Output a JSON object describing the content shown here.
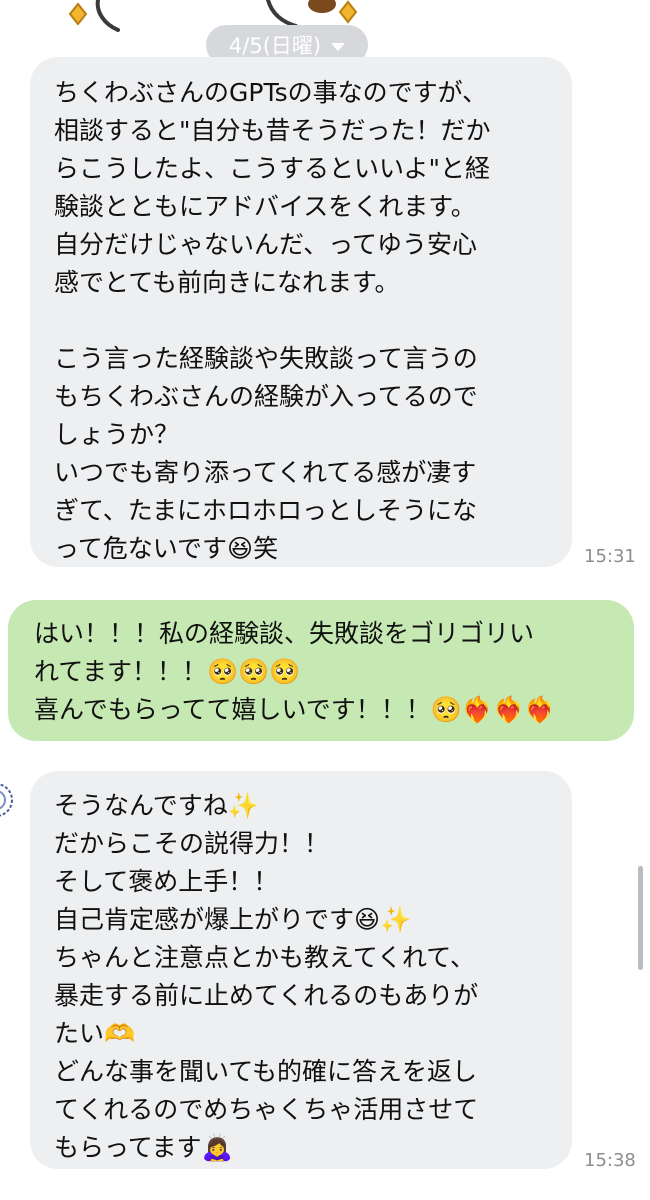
{
  "date_separator": {
    "label": "4/5(日曜)",
    "icon": "chevron-down-icon"
  },
  "messages": [
    {
      "direction": "incoming",
      "text": "ちくわぶさんのGPTsの事なのですが、\n相談すると\"自分も昔そうだった！だか\nらこうしたよ、こうするといいよ\"と経\n験談とともにアドバイスをくれます。\n自分だけじゃないんだ、ってゆう安心\n感でとても前向きになれます。\n\nこう言った経験談や失敗談って言うの\nもちくわぶさんの経験が入ってるので\nしょうか？\nいつでも寄り添ってくれてる感が凄す\nぎて、たまにホロホロっとしそうにな\nって危ないです😆笑",
      "time": "15:31"
    },
    {
      "direction": "outgoing",
      "text": "はい！！！私の経験談、失敗談をゴリゴリい\nれてます！！！🥺🥺🥺\n喜んでもらってて嬉しいです！！！🥺❤️‍🔥❤️‍🔥❤️‍🔥",
      "time": ""
    },
    {
      "direction": "incoming",
      "text": "そうなんですね✨\nだからこその説得力！！\nそして褒め上手！！\n自己肯定感が爆上がりです😆✨\nちゃんと注意点とかも教えてくれて、\n暴走する前に止めてくれるのもありが\nたい🫶\nどんな事を聞いても的確に答えを返し\nてくれるのでめちゃくちゃ活用させて\nもらってます🙇‍♀️",
      "time": "15:38"
    }
  ],
  "colors": {
    "incoming_bubble": "#eeeff1",
    "outgoing_bubble": "#c6e9b3",
    "date_pill": "#d6d8dc",
    "timestamp": "#8a8d92"
  }
}
